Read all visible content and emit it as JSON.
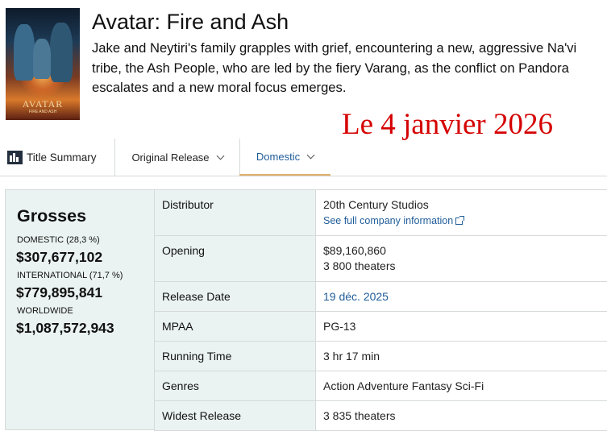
{
  "movie": {
    "title": "Avatar: Fire and Ash",
    "summary": "Jake and Neytiri's family grapples with grief, encountering a new, aggressive Na'vi tribe, the Ash People, who are led by the fiery Varang, as the conflict on Pandora escalates and a new moral focus emerges.",
    "poster_title": "AVATAR",
    "poster_subtitle": "FIRE AND ASH"
  },
  "date_stamp": "Le 4 janvier 2026",
  "tabs": {
    "title_summary": "Title Summary",
    "original_release": "Original Release",
    "domestic": "Domestic"
  },
  "grosses": {
    "title": "Grosses",
    "domestic_label": "DOMESTIC (28,3 %)",
    "domestic_value": "$307,677,102",
    "international_label": "INTERNATIONAL (71,7 %)",
    "international_value": "$779,895,841",
    "worldwide_label": "WORLDWIDE",
    "worldwide_value": "$1,087,572,943"
  },
  "details": {
    "distributor_label": "Distributor",
    "distributor_value": "20th Century Studios",
    "distributor_link": "See full company information",
    "opening_label": "Opening",
    "opening_value": "$89,160,860",
    "opening_theaters": "3 800 theaters",
    "release_date_label": "Release Date",
    "release_date_value": "19 déc. 2025",
    "mpaa_label": "MPAA",
    "mpaa_value": "PG-13",
    "running_time_label": "Running Time",
    "running_time_value": "3 hr 17 min",
    "genres_label": "Genres",
    "genres_value": "Action Adventure Fantasy Sci-Fi",
    "widest_release_label": "Widest Release",
    "widest_release_value": "3 835 theaters"
  },
  "colors": {
    "link": "#1f5c99",
    "panel_bg": "#eaf3f1",
    "stamp": "#d50000",
    "tab_active_underline": "#e0b06a"
  }
}
